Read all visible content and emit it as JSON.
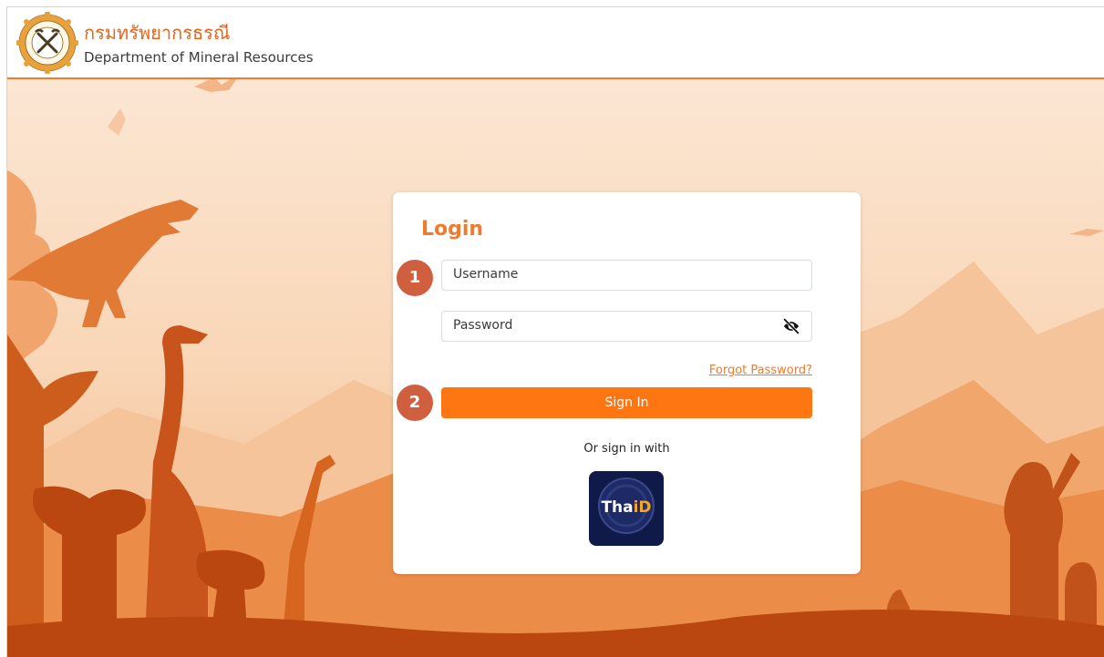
{
  "header": {
    "title_th": "กรมทรัพยากรธรณี",
    "title_en": "Department of Mineral Resources",
    "logo_icon": "dmr-seal-logo-icon"
  },
  "login": {
    "title": "Login",
    "username_placeholder": "Username",
    "password_placeholder": "Password",
    "password_toggle_icon": "eye-slash-icon",
    "forgot_label": "Forgot Password?",
    "signin_label": "Sign In",
    "or_label": "Or sign in with",
    "thaid_label_main": "Tha",
    "thaid_label_accent": "iD"
  },
  "steps": [
    "1",
    "2"
  ],
  "colors": {
    "accent": "#f07b2a",
    "button": "#fd7612",
    "step_badge": "#cf5f3f",
    "thaid_bg": "#101a48",
    "scene_light": "#fbe0c7",
    "scene_dark": "#b9470f"
  }
}
